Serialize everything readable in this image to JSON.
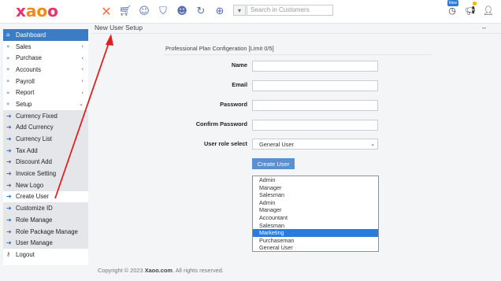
{
  "app": {
    "logo_text": "xaoo",
    "logo_color": "#e8336f",
    "logo_accent": "#f08a1c"
  },
  "topbar": {
    "icons": [
      "close-icon",
      "cart-icon",
      "add-user-icon",
      "bag-icon",
      "add-user-multiple-icon",
      "refresh-cart-icon",
      "add-bag-icon"
    ],
    "dropdown_glyph": "▾",
    "search_placeholder": "Search in Customers",
    "new_badge": "New",
    "right_icons": [
      "clock-icon",
      "megaphone-icon",
      "user-icon"
    ]
  },
  "sidebar": {
    "items": [
      {
        "label": "Dashboard",
        "icon": "home-icon",
        "glyph": "⌂",
        "active": true
      },
      {
        "label": "Sales",
        "icon": "double-chevron-icon",
        "glyph": "»",
        "arrow": "‹"
      },
      {
        "label": "Purchase",
        "icon": "double-chevron-icon",
        "glyph": "»",
        "arrow": "‹"
      },
      {
        "label": "Accounts",
        "icon": "double-chevron-icon",
        "glyph": "»",
        "arrow": "‹"
      },
      {
        "label": "Payroll",
        "icon": "double-chevron-icon",
        "glyph": "»",
        "arrow": "‹"
      },
      {
        "label": "Report",
        "icon": "double-chevron-icon",
        "glyph": "»",
        "arrow": "‹"
      },
      {
        "label": "Setup",
        "icon": "double-chevron-icon",
        "glyph": "»",
        "arrow": "⌄"
      },
      {
        "label": "Currency Fixed",
        "icon": "circle-arrow-icon",
        "glyph": "➜",
        "sub": true
      },
      {
        "label": "Add Currency",
        "icon": "circle-arrow-icon",
        "glyph": "➜",
        "sub": true
      },
      {
        "label": "Currency List",
        "icon": "circle-arrow-icon",
        "glyph": "➜",
        "sub": true
      },
      {
        "label": "Tax Add",
        "icon": "circle-arrow-icon",
        "glyph": "➜",
        "sub": true
      },
      {
        "label": "Discount Add",
        "icon": "circle-arrow-icon",
        "glyph": "➜",
        "sub": true
      },
      {
        "label": "Invoice Setting",
        "icon": "circle-arrow-icon",
        "glyph": "➜",
        "sub": true
      },
      {
        "label": "New Logo",
        "icon": "circle-arrow-icon",
        "glyph": "➜",
        "sub": true
      },
      {
        "label": "Create User",
        "icon": "circle-arrow-icon",
        "glyph": "➜",
        "sub": true,
        "current": true
      },
      {
        "label": "Customize ID",
        "icon": "circle-arrow-icon",
        "glyph": "➜",
        "sub": true
      },
      {
        "label": "Role Manage",
        "icon": "circle-arrow-icon",
        "glyph": "➜",
        "sub": true
      },
      {
        "label": "Role Package Manage",
        "icon": "circle-arrow-icon",
        "glyph": "➜",
        "sub": true
      },
      {
        "label": "User Manage",
        "icon": "circle-arrow-icon",
        "glyph": "➜",
        "sub": true
      },
      {
        "label": "Logout",
        "icon": "key-icon",
        "glyph": "⚷",
        "logout": true
      }
    ]
  },
  "page": {
    "title": "New User Setup",
    "minimize": "–",
    "plan_info": "Professional Plan Configeration [Limit 0/5]"
  },
  "form": {
    "name_label": "Name",
    "email_label": "Email",
    "password_label": "Password",
    "confirm_label": "Confirm Password",
    "role_label": "User role select",
    "role_value": "General User",
    "submit_label": "Create User",
    "role_options": [
      "Admin",
      "Manager",
      "Salesman",
      "Admin",
      "Manager",
      "Accountant",
      "Salesman",
      "Marketing",
      "Purchaseman",
      "General User"
    ],
    "selected_option_index": 7
  },
  "footer": {
    "prefix": "Copyright © 2023 ",
    "brand": "Xaoo.com",
    "suffix": ". All rights reserved."
  },
  "colors": {
    "accent": "#3c7cc4",
    "selected": "#2a7be0",
    "annotation_arrow": "#e02020"
  }
}
